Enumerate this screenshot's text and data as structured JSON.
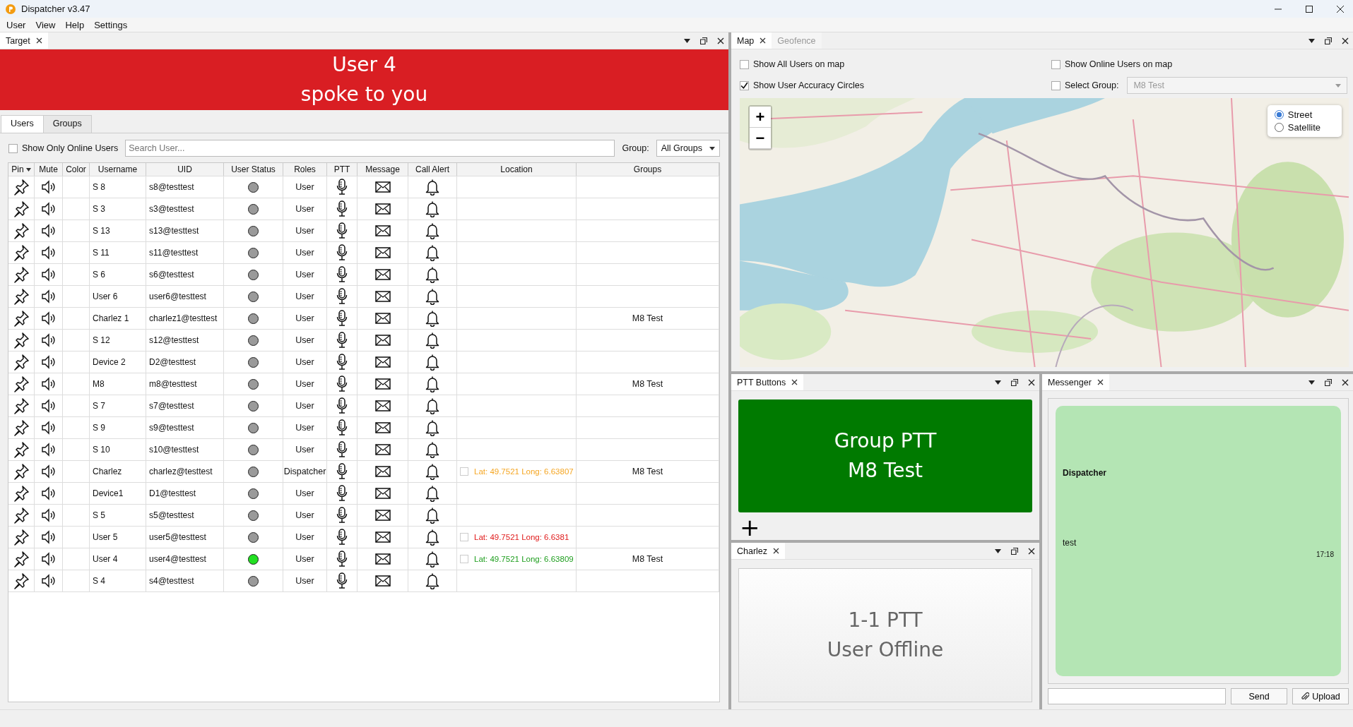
{
  "window": {
    "title": "Dispatcher v3.47"
  },
  "menu": [
    "User",
    "View",
    "Help",
    "Settings"
  ],
  "target_panel": {
    "tab": "Target",
    "banner": {
      "line_1": "User 4",
      "line_2": "spoke to you"
    },
    "tabs": [
      {
        "label": "Users",
        "selected": true
      },
      {
        "label": "Groups",
        "selected": false
      }
    ],
    "show_only_online": {
      "label": "Show Only Online Users",
      "checked": false
    },
    "search": {
      "placeholder": "Search User..."
    },
    "group_filter": {
      "label": "Group:",
      "value": "All Groups"
    },
    "table": {
      "columns": [
        "Pin",
        "Mute",
        "Color",
        "Username",
        "UID",
        "User Status",
        "Roles",
        "PTT",
        "Message",
        "Call Alert",
        "Location",
        "Groups"
      ],
      "rows": [
        {
          "username": "S 8",
          "uid": "s8@testtest",
          "online": false,
          "role": "User"
        },
        {
          "username": "S 3",
          "uid": "s3@testtest",
          "online": false,
          "role": "User"
        },
        {
          "username": "S 13",
          "uid": "s13@testtest",
          "online": false,
          "role": "User"
        },
        {
          "username": "S 11",
          "uid": "s11@testtest",
          "online": false,
          "role": "User"
        },
        {
          "username": "S 6",
          "uid": "s6@testtest",
          "online": false,
          "role": "User"
        },
        {
          "username": "User 6",
          "uid": "user6@testtest",
          "online": false,
          "role": "User"
        },
        {
          "username": "Charlez 1",
          "uid": "charlez1@testtest",
          "online": false,
          "role": "User",
          "groups": "M8 Test"
        },
        {
          "username": "S 12",
          "uid": "s12@testtest",
          "online": false,
          "role": "User"
        },
        {
          "username": "Device 2",
          "uid": "D2@testtest",
          "online": false,
          "role": "User"
        },
        {
          "username": "M8",
          "uid": "m8@testtest",
          "online": false,
          "role": "User",
          "groups": "M8 Test"
        },
        {
          "username": "S 7",
          "uid": "s7@testtest",
          "online": false,
          "role": "User"
        },
        {
          "username": "S 9",
          "uid": "s9@testtest",
          "online": false,
          "role": "User"
        },
        {
          "username": "S 10",
          "uid": "s10@testtest",
          "online": false,
          "role": "User"
        },
        {
          "username": "Charlez",
          "uid": "charlez@testtest",
          "online": false,
          "role": "Dispatcher",
          "location": {
            "checked": false,
            "text": "Lat: 49.7521 Long: 6.63807",
            "color": "#f5a623"
          },
          "groups": "M8 Test"
        },
        {
          "username": "Device1",
          "uid": "D1@testtest",
          "online": false,
          "role": "User"
        },
        {
          "username": "S 5",
          "uid": "s5@testtest",
          "online": false,
          "role": "User"
        },
        {
          "username": "User 5",
          "uid": "user5@testtest",
          "online": false,
          "role": "User",
          "location": {
            "checked": false,
            "text": "Lat: 49.7521 Long: 6.6381",
            "color": "#e01b1b"
          }
        },
        {
          "username": "User 4",
          "uid": "user4@testtest",
          "online": true,
          "role": "User",
          "location": {
            "checked": false,
            "text": "Lat: 49.7521 Long: 6.63809",
            "color": "#1e9e1e"
          },
          "groups": "M8 Test"
        },
        {
          "username": "S 4",
          "uid": "s4@testtest",
          "online": false,
          "role": "User"
        }
      ]
    }
  },
  "map_panel": {
    "tabs": [
      {
        "label": "Map",
        "selected": true
      },
      {
        "label": "Geofence",
        "selected": false
      }
    ],
    "options": [
      {
        "kind": "checkbox",
        "label": "Show All Users on map",
        "checked": false
      },
      {
        "kind": "checkbox",
        "label": "Show Online Users on map",
        "checked": false
      },
      {
        "kind": "checkbox",
        "label": "Show User Accuracy Circles",
        "checked": true
      },
      {
        "kind": "group_select",
        "label": "Select Group:",
        "checked": false,
        "value": "M8 Test",
        "disabled": true
      }
    ],
    "zoom_in": "+",
    "zoom_out": "−",
    "layers": [
      {
        "label": "Street",
        "selected": true
      },
      {
        "label": "Satellite",
        "selected": false
      }
    ]
  },
  "ptt_panel": {
    "tab": "PTT Buttons",
    "button": {
      "line_1": "Group PTT",
      "line_2": "M8 Test"
    },
    "add": "+"
  },
  "private_panel": {
    "tab": "Charlez",
    "button": {
      "line_1": "1-1 PTT",
      "line_2": "User Offline"
    }
  },
  "messenger": {
    "tab": "Messenger",
    "messages": [
      {
        "sender": "Dispatcher",
        "text": "test",
        "time": "17:18"
      }
    ],
    "send": "Send",
    "upload": "Upload"
  }
}
